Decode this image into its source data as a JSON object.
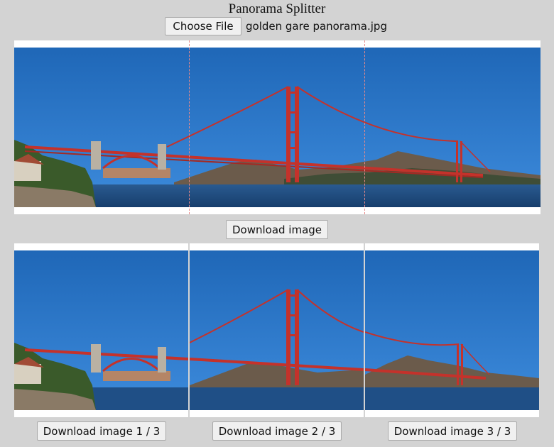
{
  "app": {
    "title": "Panorama Splitter"
  },
  "file_input": {
    "button_label": "Choose File",
    "file_name": "golden gare panorama.jpg"
  },
  "panorama": {
    "alt": "Golden Gate Bridge panorama",
    "splits": 3
  },
  "download_main": {
    "label": "Download image"
  },
  "parts": [
    {
      "label": "Download image 1 / 3"
    },
    {
      "label": "Download image 2 / 3"
    },
    {
      "label": "Download image 3 / 3"
    }
  ],
  "colors": {
    "page_bg": "#d3d3d3",
    "sky_top": "#1f67b7",
    "sky_bottom": "#3a86d7",
    "bridge_red": "#c4322b",
    "water": "#1f4f86",
    "hills": "#6b5b4b",
    "split_line": "#e88a8a"
  }
}
